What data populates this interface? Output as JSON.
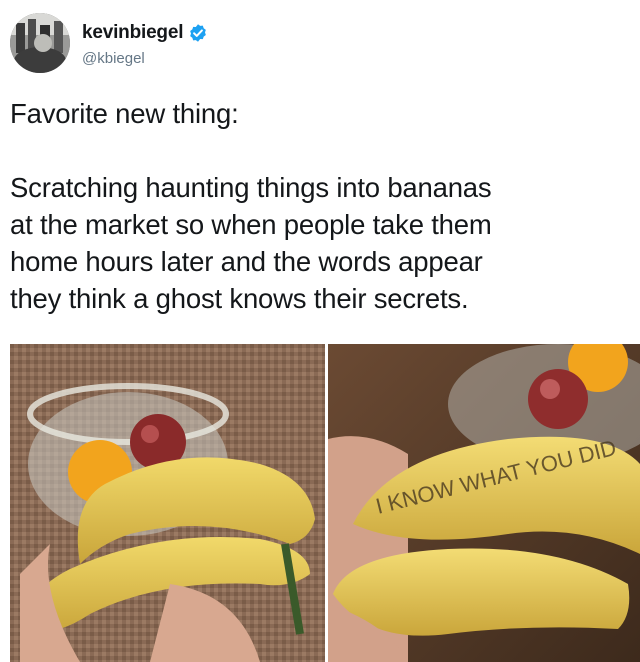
{
  "author": {
    "display_name": "kevinbiegel",
    "handle": "@kbiegel",
    "verified_icon": "verified-badge-icon",
    "verified_color": "#1da1f2"
  },
  "tweet": {
    "line1": "Favorite new thing:",
    "body_lines": [
      "Scratching haunting things into bananas",
      "at the market so when people take them",
      "home hours later and the words appear",
      "they think a ghost knows their secrets."
    ]
  },
  "photos": {
    "left": {
      "alt": "two bananas in hand in front of a fruit bowl with an orange and a plum"
    },
    "right": {
      "banana_text": "I KNOW WHAT YOU DID"
    }
  }
}
